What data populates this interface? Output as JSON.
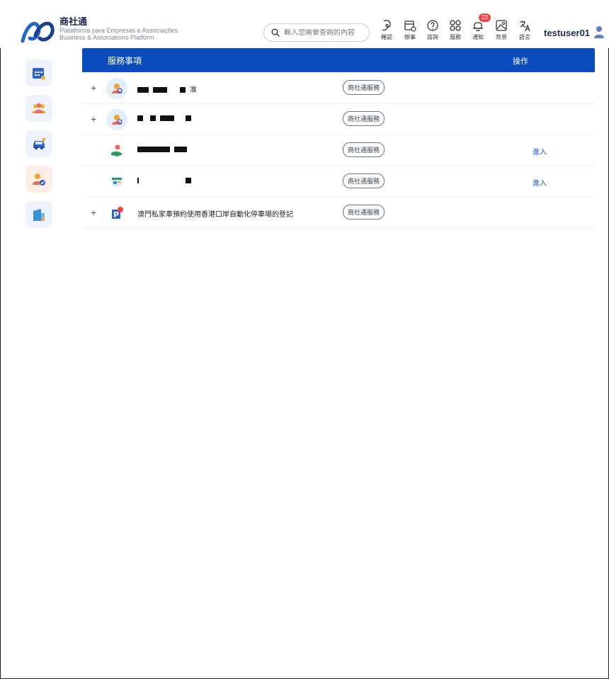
{
  "header": {
    "brand_name": "商社通",
    "brand_sub_pt": "Plataforma para Empresas e Associações",
    "brand_sub_en": "Business & Associations Platform",
    "search_placeholder": "輸入您需要查詢的內容",
    "tools": [
      {
        "label": "確認",
        "icon": "fingerprint-icon"
      },
      {
        "label": "辦事",
        "icon": "briefcase-icon"
      },
      {
        "label": "諮詢",
        "icon": "question-icon"
      },
      {
        "label": "服務",
        "icon": "grid-icon"
      },
      {
        "label": "通知",
        "icon": "bell-icon",
        "badge": "23"
      },
      {
        "label": "背景",
        "icon": "image-icon"
      },
      {
        "label": "語言",
        "icon": "translate-icon"
      }
    ],
    "username": "testuser01"
  },
  "sidebar": {
    "items": [
      {
        "icon": "calendar-icon"
      },
      {
        "icon": "people-icon"
      },
      {
        "icon": "car-icon"
      },
      {
        "icon": "user-check-icon"
      },
      {
        "icon": "building-icon"
      }
    ]
  },
  "table": {
    "col_service": "服務事項",
    "col_action": "操作",
    "rows": [
      {
        "expand": "+",
        "name_suffix": "准",
        "tag": "商社通服務",
        "action": ""
      },
      {
        "expand": "+",
        "name_suffix": "",
        "tag": "商社通服務",
        "action": ""
      },
      {
        "expand": "",
        "name_suffix": "",
        "tag": "商社通服務",
        "action": "進入"
      },
      {
        "expand": "",
        "name_suffix": "",
        "tag": "商社通服務",
        "action": "進入"
      },
      {
        "expand": "+",
        "name": "澳門私家車預約使用香港口岸自動化停車場的登記",
        "tag": "商社通服務",
        "action": ""
      }
    ]
  },
  "colors": {
    "header_bar": "#0a4bbe",
    "link": "#1755c9",
    "badge": "#f04848"
  }
}
